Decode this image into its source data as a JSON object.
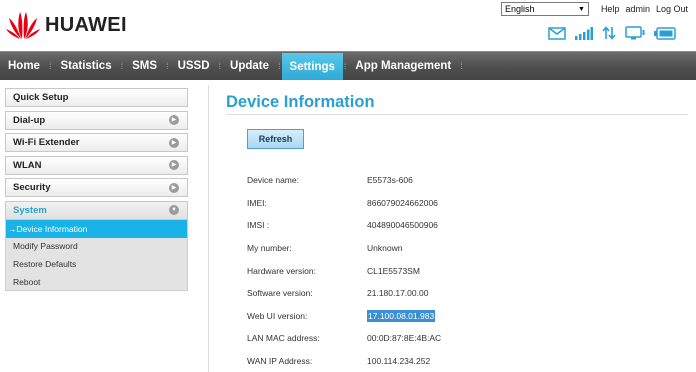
{
  "brand": {
    "name": "HUAWEI",
    "logo_color": "#e60012"
  },
  "top_bar": {
    "language": "English",
    "help": "Help",
    "admin": "admin",
    "logout": "Log Out"
  },
  "status_icons": [
    "message-icon",
    "signal-icon",
    "data-transfer-icon",
    "wifi-device-icon",
    "battery-icon"
  ],
  "nav": {
    "items": [
      {
        "label": "Home"
      },
      {
        "label": "Statistics"
      },
      {
        "label": "SMS"
      },
      {
        "label": "USSD"
      },
      {
        "label": "Update"
      },
      {
        "label": "Settings",
        "active": true
      },
      {
        "label": "App Management"
      }
    ]
  },
  "sidebar": {
    "quick_setup": "Quick Setup",
    "items": [
      {
        "label": "Dial-up"
      },
      {
        "label": "Wi-Fi Extender"
      },
      {
        "label": "WLAN"
      },
      {
        "label": "Security"
      }
    ],
    "expanded": {
      "label": "System",
      "sub_items": [
        {
          "label": "Device Information",
          "active": true
        },
        {
          "label": "Modify Password"
        },
        {
          "label": "Restore Defaults"
        },
        {
          "label": "Reboot"
        }
      ]
    }
  },
  "main": {
    "title": "Device Information",
    "refresh_label": "Refresh",
    "rows": [
      {
        "label": "Device name:",
        "value": "E5573s-606"
      },
      {
        "label": "IMEI:",
        "value": "866079024662006"
      },
      {
        "label": "IMSI :",
        "value": "404890046500906"
      },
      {
        "label": "My number:",
        "value": "Unknown"
      },
      {
        "label": "Hardware version:",
        "value": "CL1E5573SM"
      },
      {
        "label": "Software version:",
        "value": "21.180.17.00.00"
      },
      {
        "label": "Web UI version:",
        "value": "17.100.08.01.983"
      },
      {
        "label": "LAN MAC address:",
        "value": "00:0D:87:8E:4B:AC"
      },
      {
        "label": "WAN IP Address:",
        "value": "100.114.234.252"
      }
    ]
  },
  "colors": {
    "accent": "#2a9fd2",
    "nav_active": "#3db7e4",
    "nav_bg": "#505050",
    "highlight": "#3b8fd6"
  }
}
